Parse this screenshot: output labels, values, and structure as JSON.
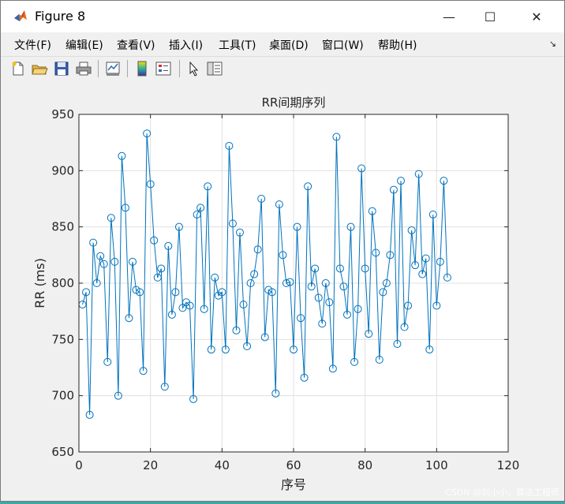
{
  "window": {
    "title": "Figure 8",
    "minimize_glyph": "—",
    "maximize_glyph": "☐",
    "close_glyph": "✕"
  },
  "menu": {
    "items": [
      "文件(F)",
      "编辑(E)",
      "查看(V)",
      "插入(I)",
      "工具(T)",
      "桌面(D)",
      "窗口(W)",
      "帮助(H)"
    ]
  },
  "toolbar": {
    "icons": [
      "new-figure-icon",
      "open-file-icon",
      "save-icon",
      "print-icon",
      "link-plot-icon",
      "colorbar-icon",
      "legend-icon",
      "pointer-icon",
      "property-inspector-icon"
    ]
  },
  "watermark": "CSDN @刘小小，算法工程师",
  "colors": {
    "series": "#0072bd",
    "axes_bg": "#ffffff",
    "grid": "#e0e0e0",
    "figure_bg": "#f0f0f0"
  },
  "chart_data": {
    "type": "line",
    "title": "RR间期序列",
    "xlabel": "序号",
    "ylabel": "RR (ms)",
    "xlim": [
      0,
      120
    ],
    "ylim": [
      650,
      950
    ],
    "xticks": [
      0,
      20,
      40,
      60,
      80,
      100,
      120
    ],
    "yticks": [
      650,
      700,
      750,
      800,
      850,
      900,
      950
    ],
    "grid": true,
    "marker": "circle",
    "series": [
      {
        "x": [
          1,
          2,
          3,
          4,
          5,
          6,
          7,
          8,
          9,
          10,
          11,
          12,
          13,
          14,
          15,
          16,
          17,
          18,
          19,
          20,
          21,
          22,
          23,
          24,
          25,
          26,
          27,
          28,
          29,
          30,
          31,
          32,
          33,
          34,
          35,
          36,
          37,
          38,
          39,
          40,
          41,
          42,
          43,
          44,
          45,
          46,
          47,
          48,
          49,
          50,
          51,
          52,
          53,
          54,
          55,
          56,
          57,
          58,
          59,
          60,
          61,
          62,
          63,
          64,
          65,
          66,
          67,
          68,
          69,
          70,
          71,
          72,
          73,
          74,
          75,
          76,
          77,
          78,
          79,
          80,
          81,
          82,
          83,
          84,
          85,
          86,
          87,
          88,
          89,
          90,
          91,
          92,
          93,
          94,
          95,
          96,
          97,
          98,
          99,
          100,
          101,
          102,
          103
        ],
        "values": [
          781,
          792,
          683,
          836,
          800,
          824,
          817,
          730,
          858,
          819,
          700,
          913,
          867,
          769,
          819,
          794,
          792,
          722,
          933,
          888,
          838,
          805,
          813,
          708,
          833,
          772,
          792,
          850,
          778,
          783,
          780,
          697,
          861,
          867,
          777,
          886,
          741,
          805,
          789,
          792,
          741,
          922,
          853,
          758,
          845,
          781,
          744,
          800,
          808,
          830,
          875,
          752,
          794,
          792,
          702,
          870,
          825,
          800,
          801,
          741,
          850,
          769,
          716,
          886,
          797,
          813,
          787,
          764,
          800,
          783,
          724,
          930,
          813,
          797,
          772,
          850,
          730,
          777,
          902,
          813,
          755,
          864,
          827,
          732,
          792,
          800,
          825,
          883,
          746,
          891,
          761,
          780,
          847,
          816,
          897,
          808,
          822,
          741,
          861,
          780,
          819,
          891,
          805
        ]
      }
    ]
  }
}
